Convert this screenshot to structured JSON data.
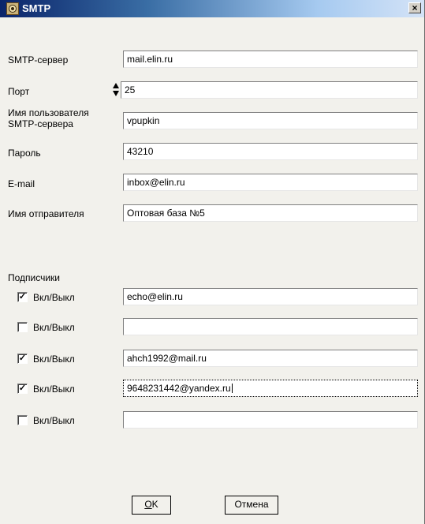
{
  "window": {
    "title": "SMTP",
    "close_glyph": "×"
  },
  "fields": {
    "smtp_server": {
      "label": "SMTP-сервер",
      "value": "mail.elin.ru"
    },
    "port": {
      "label": "Порт",
      "value": "25"
    },
    "username": {
      "label": "Имя пользователя\nSMTP-сервера",
      "value": "vpupkin"
    },
    "password": {
      "label": "Пароль",
      "value": "43210"
    },
    "email": {
      "label": "E-mail",
      "value": "inbox@elin.ru"
    },
    "sender_name": {
      "label": "Имя отправителя",
      "value": "Оптовая база №5"
    }
  },
  "subscribers": {
    "heading": "Подписчики",
    "toggle_label": "Вкл/Выкл",
    "items": [
      {
        "checked": true,
        "check_glyph": "✓",
        "value": "echo@elin.ru"
      },
      {
        "checked": false,
        "check_glyph": "",
        "value": ""
      },
      {
        "checked": true,
        "check_glyph": "✓",
        "value": "ahch1992@mail.ru"
      },
      {
        "checked": true,
        "check_glyph": "✓",
        "value": "9648231442@yandex.ru"
      },
      {
        "checked": false,
        "check_glyph": "",
        "value": ""
      }
    ]
  },
  "buttons": {
    "ok_label": "OK",
    "ok_first": "O",
    "ok_rest": "K",
    "cancel_label": "Отмена"
  },
  "icons": {
    "app": "smtp-app-icon",
    "close": "close-icon",
    "spinner": "spin-arrows-icon"
  }
}
